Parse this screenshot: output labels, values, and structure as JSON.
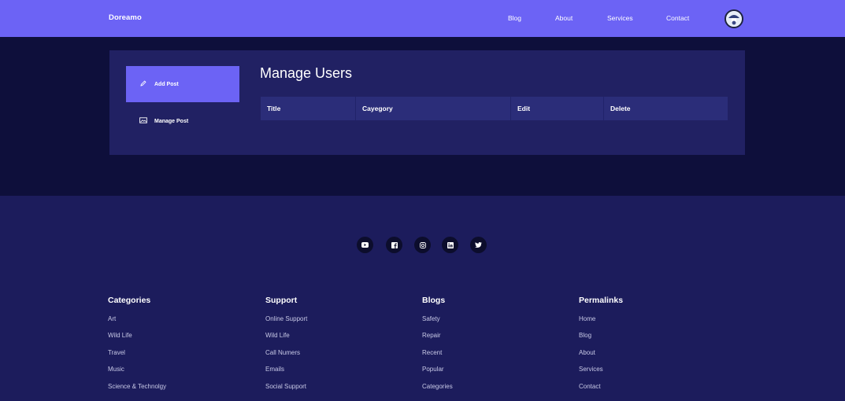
{
  "navbar": {
    "brand": "Doreamo",
    "links": [
      "Blog",
      "About",
      "Services",
      "Contact"
    ],
    "avatar_icon": "user-avatar-icon"
  },
  "sidebar": {
    "items": [
      {
        "label": "Add Post",
        "icon": "pencil-icon",
        "active": true
      },
      {
        "label": "Manage Post",
        "icon": "image-icon",
        "active": false
      }
    ]
  },
  "main": {
    "title": "Manage Users",
    "table": {
      "columns": [
        "Title",
        "Cayegory",
        "Edit",
        "Delete"
      ],
      "rows": []
    }
  },
  "footer": {
    "social_icons": [
      "youtube-icon",
      "facebook-icon",
      "instagram-icon",
      "linkedin-icon",
      "twitter-icon"
    ],
    "columns": [
      {
        "title": "Categories",
        "links": [
          "Art",
          "Wild Life",
          "Travel",
          "Music",
          "Science & Technolgy"
        ]
      },
      {
        "title": "Support",
        "links": [
          "Online Support",
          "Wild Life",
          "Call Numers",
          "Emails",
          "Social Support"
        ]
      },
      {
        "title": "Blogs",
        "links": [
          "Safety",
          "Repair",
          "Recent",
          "Popular",
          "Categories"
        ]
      },
      {
        "title": "Permalinks",
        "links": [
          "Home",
          "Blog",
          "About",
          "Services",
          "Contact"
        ]
      }
    ]
  },
  "colors": {
    "navbar": "#6c63f5",
    "page_bg": "#0e0f3b",
    "card": "#212163",
    "active_item": "#6c63f5",
    "table_header": "#2b2d79",
    "footer": "#1c1c5c"
  }
}
